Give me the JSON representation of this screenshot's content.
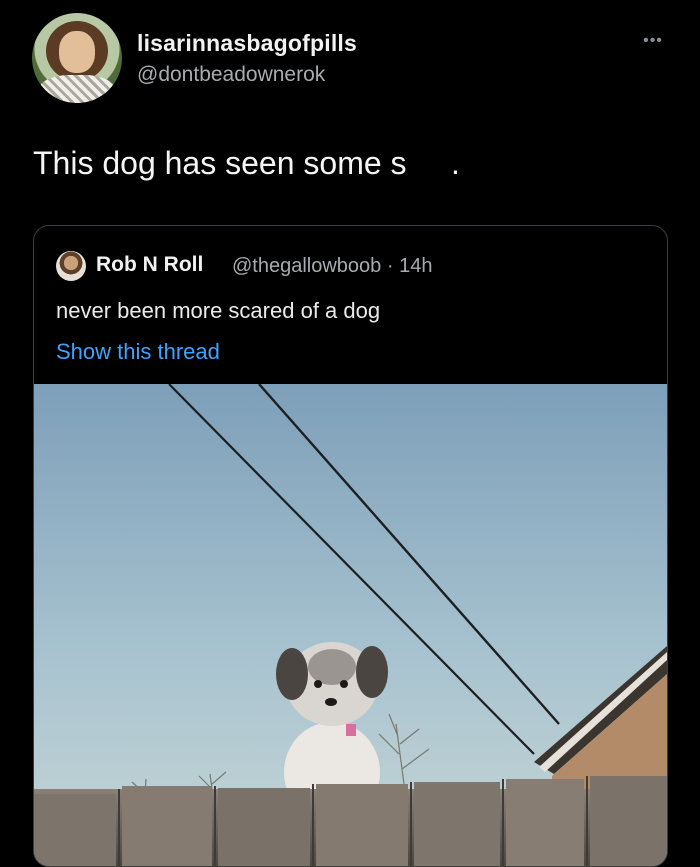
{
  "author": {
    "display_name": "lisarinnasbagofpills",
    "handle": "@dontbeadownerok"
  },
  "tweet": {
    "text": "This dog has seen some s     ."
  },
  "menu": {
    "more_icon": "more-horizontal-icon",
    "more_glyph": "•••"
  },
  "quoted_tweet": {
    "display_name": "Rob N Roll",
    "handle_time": "@thegallowboob · 14h",
    "text": "never been more scared of a dog",
    "thread_link": "Show this thread",
    "link_color": "#3ea3ff"
  },
  "colors": {
    "background": "#000000",
    "text_primary": "#f2f2f2",
    "text_secondary": "#a7abb0",
    "border": "#3a3d41"
  }
}
